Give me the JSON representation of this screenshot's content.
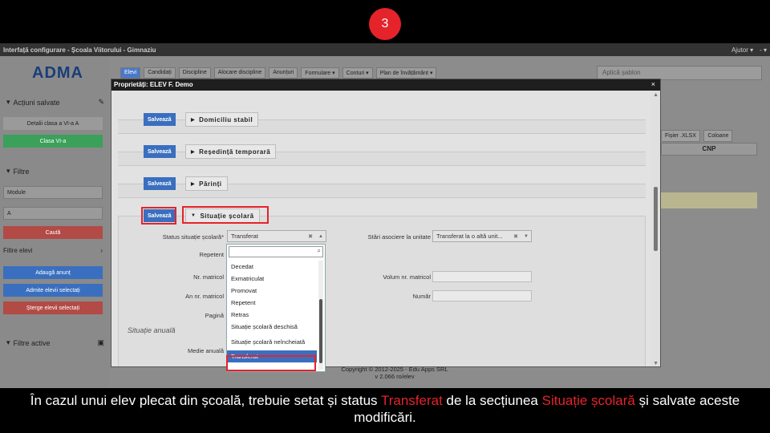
{
  "step_number": "3",
  "window_title": "Interfață configurare - Școala Viitorului - Gimnaziu",
  "help_menu": "Ajutor ▾",
  "extra_menu": "- ▾",
  "logo": "ADMA",
  "sidebar": {
    "saved_actions": "Acțiuni salvate",
    "saved_item_1": "Detalii clasa a VI-a A",
    "saved_item_2": "Clasa VI-a",
    "filters": "Filtre",
    "module_label": "Module",
    "filter_value": "A",
    "search_button": "Caută",
    "student_filters": "Filtre elevi",
    "add_notice": "Adaugă anunț",
    "admit_selected": "Admite elevii selectați",
    "delete_selected": "Șterge elevii selectați",
    "active_filters": "Filtre active"
  },
  "nav_tabs": [
    "Elevi",
    "Candidați",
    "Discipline",
    "Alocare discipline",
    "Anunțuri",
    "Formulare ▾",
    "Conturi ▾",
    "Plan de învățământ ▾"
  ],
  "search_placeholder": "Aplică șablon",
  "bg_buttons": {
    "xlsx": "Fișier .XLSX",
    "columns": "Coloane"
  },
  "cnp_header": "CNP",
  "modal": {
    "title": "Proprietăți: ELEV F. Demo",
    "close": "×",
    "save_label": "Salvează",
    "sections": [
      "Domiciliu stabil",
      "Reședință temporară",
      "Părinți",
      "Situație școlară"
    ]
  },
  "form": {
    "status_label": "Status situație școlară*",
    "status_value": "Transferat",
    "repeater_label": "Repetent",
    "reg_no_label": "Nr. matricol",
    "reg_year_label": "An nr. matricol",
    "page_label": "Pagină",
    "annual_heading": "Situație anuală",
    "annual_avg_label": "Medie anuală",
    "unit_assoc_label": "Stări asociere la unitate",
    "unit_assoc_value": "Transferat la o altă unit...",
    "reg_volume_label": "Volum nr. matricol",
    "number_label": "Număr"
  },
  "dropdown": {
    "options": [
      "Decedat",
      "Exmatriculat",
      "Promovat",
      "Repetent",
      "Retras",
      "Situație școlară deschisă",
      "Situație școlară neîncheiată",
      "Transferat"
    ],
    "selected": "Transferat"
  },
  "footer": {
    "copyright": "Copyright © 2012-2025 - Edu Apps SRL",
    "version": "v 2.066 ro/elev"
  },
  "caption": {
    "part1": "În cazul unui elev plecat din școală, trebuie setat și status ",
    "hl1": "Transferat",
    "part2": " de la secțiunea ",
    "hl2": "Situație școlară",
    "part3": " și salvate aceste modificări."
  },
  "colors": {
    "accent": "#e5232a",
    "primary": "#3a6fbf",
    "green": "#3aa05a",
    "red": "#c9302c"
  }
}
